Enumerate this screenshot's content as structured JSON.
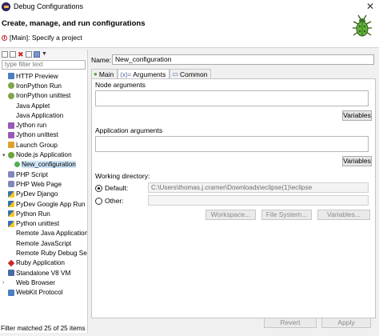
{
  "window": {
    "title": "Debug Configurations",
    "close_glyph": "✕"
  },
  "header": {
    "title": "Create, manage, and run configurations",
    "message": "[Main]: Specify a project"
  },
  "left": {
    "filter_placeholder": "type filter text",
    "items": [
      {
        "label": "HTTP Preview",
        "icon": "web-icon"
      },
      {
        "label": "IronPython Run",
        "icon": "ironpython-icon"
      },
      {
        "label": "IronPython unittest",
        "icon": "ironpython-icon"
      },
      {
        "label": "Java Applet",
        "icon": "none"
      },
      {
        "label": "Java Application",
        "icon": "none"
      },
      {
        "label": "Jython run",
        "icon": "jython-icon"
      },
      {
        "label": "Jython unittest",
        "icon": "jython-icon"
      },
      {
        "label": "Launch Group",
        "icon": "launch-group-icon"
      },
      {
        "label": "Node.js Application",
        "icon": "nodejs-icon",
        "expanded": true
      },
      {
        "label": "New_configuration",
        "icon": "nodejs-config-icon",
        "child": true,
        "selected": true
      },
      {
        "label": "PHP Script",
        "icon": "php-icon"
      },
      {
        "label": "PHP Web Page",
        "icon": "php-icon"
      },
      {
        "label": "PyDev Django",
        "icon": "pydev-icon"
      },
      {
        "label": "PyDev Google App Run",
        "icon": "pydev-icon"
      },
      {
        "label": "Python Run",
        "icon": "python-icon"
      },
      {
        "label": "Python unittest",
        "icon": "python-icon"
      },
      {
        "label": "Remote Java Application",
        "icon": "none"
      },
      {
        "label": "Remote JavaScript",
        "icon": "none"
      },
      {
        "label": "Remote Ruby Debug Ses",
        "icon": "none"
      },
      {
        "label": "Ruby Application",
        "icon": "ruby-icon"
      },
      {
        "label": "Standalone V8 VM",
        "icon": "v8-icon"
      },
      {
        "label": "Web Browser",
        "icon": "none",
        "expandable": true
      },
      {
        "label": "WebKit Protocol",
        "icon": "webkit-icon"
      }
    ],
    "status": "Filter matched 25 of 25 items"
  },
  "right": {
    "name_label": "Name:",
    "name_value": "New_configuration",
    "tabs": [
      {
        "label": "Main",
        "icon": "main-tab-icon"
      },
      {
        "label": "Arguments",
        "icon": "arguments-tab-icon",
        "active": true
      },
      {
        "label": "Common",
        "icon": "common-tab-icon"
      }
    ],
    "node_args_label": "Node arguments",
    "app_args_label": "Application arguments",
    "variables_label": "Variables",
    "working_dir_label": "Working directory:",
    "default_label": "Default:",
    "default_path": "C:\\Users\\thomas.j.cramer\\Downloads\\eclipse(1)\\eclipse",
    "other_label": "Other:",
    "workspace_label": "Workspace...",
    "filesystem_label": "File System...",
    "variables_dots_label": "Variables...",
    "revert_label": "Revert",
    "apply_label": "Apply"
  },
  "colors": {
    "selection": "#cde4f7",
    "error": "#c8262b",
    "node_green": "#6ba33c"
  }
}
